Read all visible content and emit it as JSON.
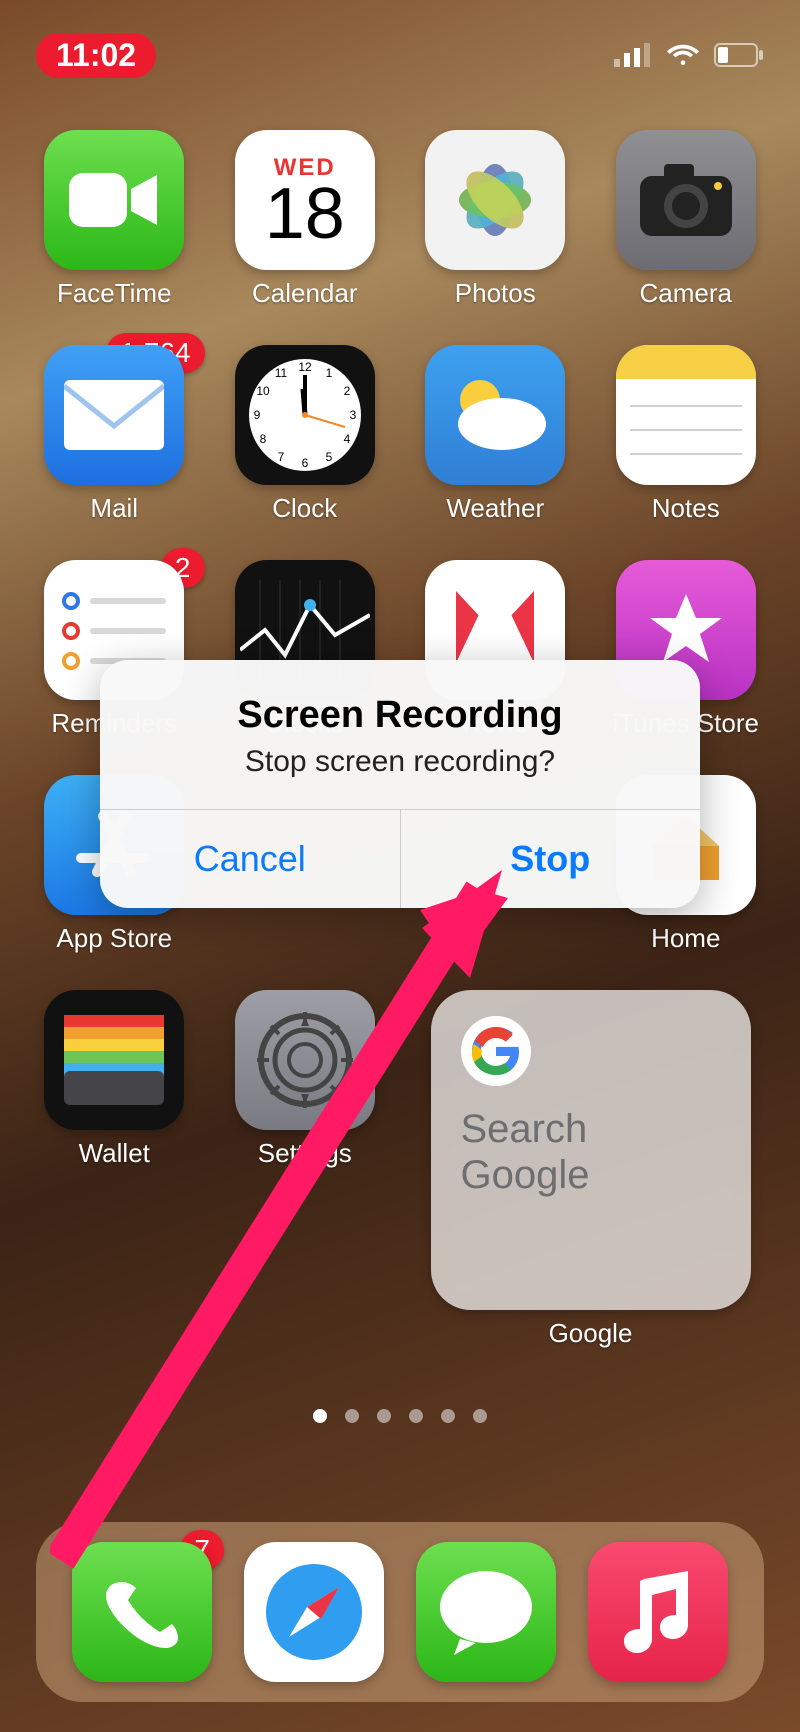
{
  "status": {
    "time": "11:02"
  },
  "calendar": {
    "day": "WED",
    "date": "18"
  },
  "apps": {
    "facetime": {
      "label": "FaceTime"
    },
    "calendar": {
      "label": "Calendar"
    },
    "photos": {
      "label": "Photos"
    },
    "camera": {
      "label": "Camera"
    },
    "mail": {
      "label": "Mail",
      "badge": "1,764"
    },
    "clock": {
      "label": "Clock"
    },
    "weather": {
      "label": "Weather"
    },
    "notes": {
      "label": "Notes"
    },
    "reminders": {
      "label": "Reminders",
      "badge": "2"
    },
    "stocks": {
      "label": "Stocks"
    },
    "news": {
      "label": "News"
    },
    "itunes": {
      "label": "iTunes Store"
    },
    "appstore": {
      "label": "App Store"
    },
    "home": {
      "label": "Home"
    },
    "wallet": {
      "label": "Wallet"
    },
    "settings": {
      "label": "Settings"
    },
    "phone": {
      "badge": "7"
    }
  },
  "google_widget": {
    "placeholder": "Search Google",
    "label": "Google"
  },
  "alert": {
    "title": "Screen Recording",
    "message": "Stop screen recording?",
    "cancel": "Cancel",
    "confirm": "Stop"
  },
  "page_indicator": {
    "count": 6,
    "active": 0
  }
}
